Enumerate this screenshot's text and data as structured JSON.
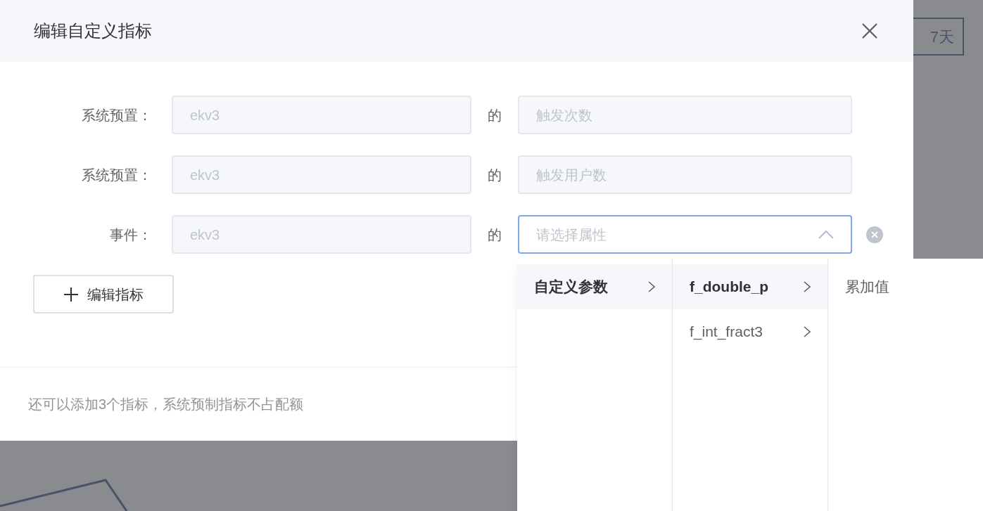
{
  "background": {
    "range_button": "7天"
  },
  "dialog": {
    "title": "编辑自定义指标",
    "rows": [
      {
        "kind": "preset",
        "label": "系统预置：",
        "source": "ekv3",
        "joiner": "的",
        "metric": "触发次数"
      },
      {
        "kind": "preset",
        "label": "系统预置：",
        "source": "ekv3",
        "joiner": "的",
        "metric": "触发用户数"
      },
      {
        "kind": "select",
        "label": "事件：",
        "source": "ekv3",
        "joiner": "的",
        "placeholder": "请选择属性",
        "expanded": true
      }
    ],
    "add_button": "编辑指标",
    "footer_note": "还可以添加3个指标，系统预制指标不占配额"
  },
  "cascader": {
    "columns": [
      [
        {
          "label": "自定义参数",
          "selected": true,
          "has_children": true
        }
      ],
      [
        {
          "label": "f_double_p",
          "selected": true,
          "has_children": true
        },
        {
          "label": "f_int_fract3",
          "selected": false,
          "has_children": true
        }
      ],
      [
        {
          "label": "累加值",
          "selected": false,
          "has_children": false
        }
      ]
    ]
  }
}
